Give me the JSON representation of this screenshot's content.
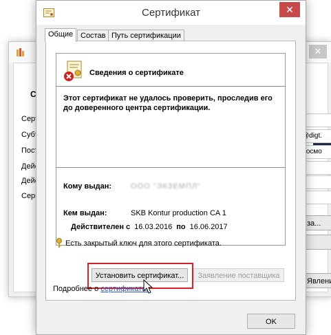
{
  "dialog": {
    "title": "Сертификат",
    "close_glyph": "✕",
    "tabs": [
      {
        "label": "Общие"
      },
      {
        "label": "Состав"
      },
      {
        "label": "Путь сертификации"
      }
    ],
    "info": {
      "heading": "Сведения о сертификате",
      "error_text": "Этот сертификат не удалось проверить, проследив его до доверенного центра сертификации.",
      "issued_to_label": "Кому выдан:",
      "issued_to_value": "ООО \"ЭКЗЕМПЛ\"",
      "issued_by_label": "Кем выдан:",
      "issued_by_value": "SKB Kontur production CA 1",
      "valid_from_label": "Действителен с",
      "valid_from": "16.03.2016",
      "valid_to_label": "по",
      "valid_to": "16.06.2017",
      "private_key_text": "Есть закрытый ключ для этого сертификата."
    },
    "buttons": {
      "install": "Установить сертификат...",
      "provider_statement": "Заявление поставщика",
      "ok": "OK"
    },
    "more_prefix": "Подробнее о",
    "more_link": "сертификатах"
  },
  "back_window": {
    "heading_fragment": "Све",
    "labels": [
      "Серт",
      "Субъ",
      "Пост",
      "Дейс",
      "Дейс",
      "Сери"
    ],
    "fields": [
      "",
      "@digt.",
      "Космо",
      "",
      "",
      ""
    ],
    "buttons": [
      "за...",
      "",
      "Явление"
    ],
    "close_glyph": "✕"
  },
  "colors": {
    "highlight": "#d8202a",
    "link": "#2a55b8",
    "close_button": "#c74a4a"
  }
}
